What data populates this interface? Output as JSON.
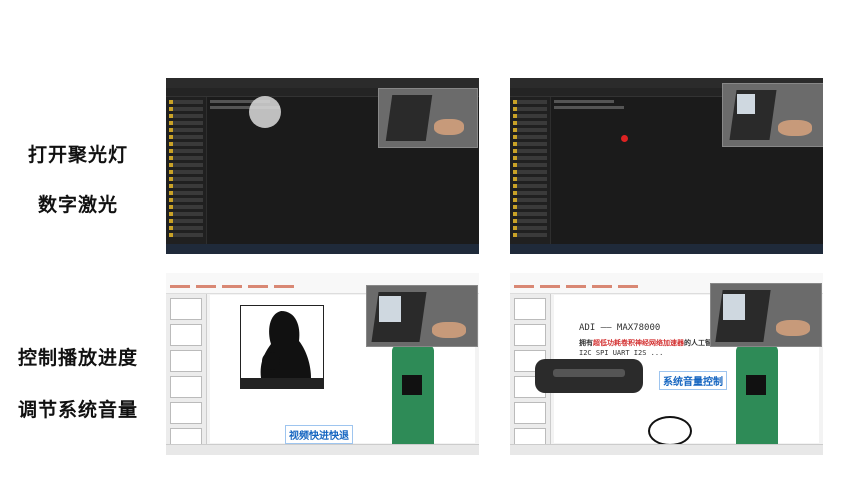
{
  "labels": {
    "row1_a": "打开聚光灯",
    "row1_b": "数字激光",
    "row2_a": "控制播放进度",
    "row2_b": "调节系统音量"
  },
  "slide_bottom_left": {
    "caption": "视频快进快退"
  },
  "slide_bottom_right": {
    "caption": "系统音量控制",
    "heading": "ADI —— MAX78000",
    "line1_prefix": "拥有",
    "line1_highlight": "超低功耗卷积神经网络加速器",
    "line1_suffix": "的人工智能微",
    "line2": "I2C SPI UART I2S ..."
  },
  "colors": {
    "accent_blue": "#1565c0",
    "highlight_red": "#d32f2f",
    "folder_yellow": "#c9a227"
  }
}
